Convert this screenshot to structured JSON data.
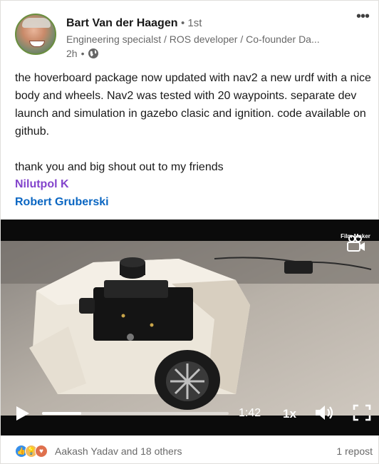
{
  "post": {
    "author": {
      "name": "Bart Van der Haagen",
      "degree": "• 1st",
      "headline": "Engineering specialst / ROS developer / Co-founder Da...",
      "time": "2h",
      "separator": "•"
    },
    "text": {
      "paragraph1": "the hoverboard package now updated with nav2 a new urdf with a nice body and wheels. Nav2 was tested with 20 waypoints. separate dev launch and simulation in gazebo clasic and ignition. code available on github.",
      "paragraph2": "thank you and big shout out to my friends"
    },
    "mentions": [
      "Nilutpol K",
      "Robert Gruberski"
    ],
    "video": {
      "watermark": "Film Maker",
      "duration": "1:42",
      "speed": "1x",
      "progress_fraction": 0.21
    },
    "social": {
      "reactions_text": "Aakash Yadav and 18 others",
      "reposts": "1 repost",
      "reaction_icons": [
        "like-icon",
        "insightful-icon",
        "love-icon"
      ]
    }
  },
  "colors": {
    "mention_purple": "#8344cc",
    "mention_blue": "#0a66c2",
    "secondary_text": "#00000099"
  }
}
